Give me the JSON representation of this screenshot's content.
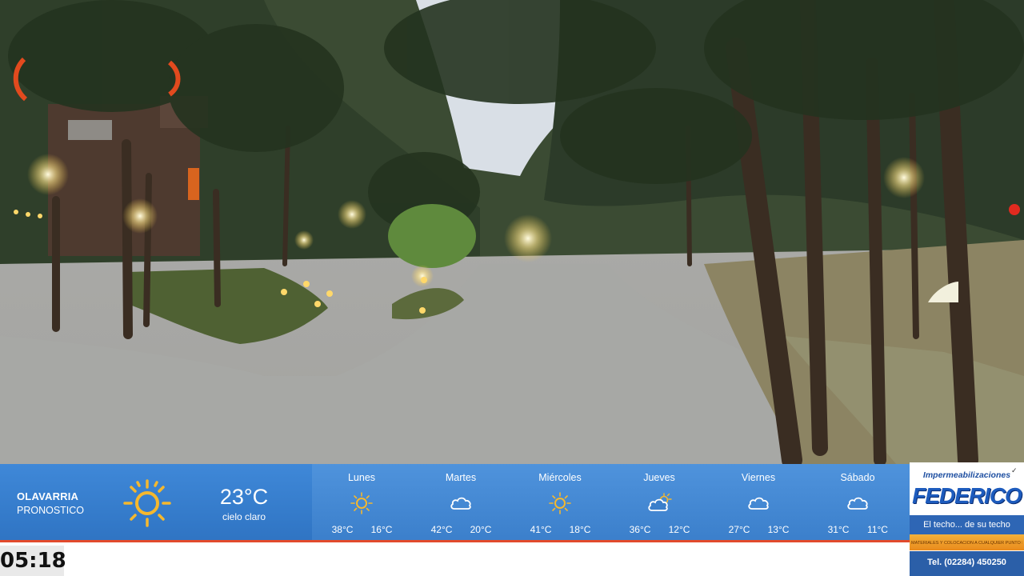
{
  "current": {
    "city": "OLAVARRIA",
    "subtitle": "PRONOSTICO",
    "icon": "sun-icon",
    "temperature": "23°C",
    "condition": "cielo claro"
  },
  "forecast": [
    {
      "day": "Lunes",
      "icon": "sun-icon",
      "max": "38°C",
      "min": "16°C"
    },
    {
      "day": "Martes",
      "icon": "cloud-icon",
      "max": "42°C",
      "min": "20°C"
    },
    {
      "day": "Miércoles",
      "icon": "sun-icon",
      "max": "41°C",
      "min": "18°C"
    },
    {
      "day": "Jueves",
      "icon": "partly-cloudy-icon",
      "max": "36°C",
      "min": "12°C"
    },
    {
      "day": "Viernes",
      "icon": "cloud-icon",
      "max": "27°C",
      "min": "13°C"
    },
    {
      "day": "Sábado",
      "icon": "cloud-icon",
      "max": "31°C",
      "min": "11°C"
    }
  ],
  "clock": "05:18",
  "ad": {
    "top": "Impermeabilizaciones",
    "brand": "FEDERICO",
    "slogan": "El techo... de su techo",
    "fine_print": "MATERIALES Y COLOCACION A CUALQUIER PUNTO DEL PAIS",
    "phone": "Tel. (02284) 450250"
  },
  "colors": {
    "bar": "#3b7fcb",
    "accent_line": "#e24a2c",
    "sun": "#f5b82e"
  }
}
